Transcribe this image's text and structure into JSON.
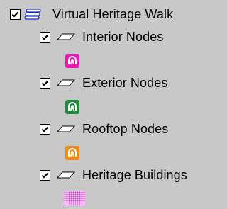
{
  "root": {
    "label": "Virtual Heritage Walk",
    "checked": true,
    "icon": "stacked-layers-icon"
  },
  "layers": [
    {
      "label": "Interior Nodes",
      "checked": true,
      "icon": "polygon-layer-icon",
      "symbol": "marker-icon",
      "symbol_color": "#e81ab4"
    },
    {
      "label": "Exterior Nodes",
      "checked": true,
      "icon": "polygon-layer-icon",
      "symbol": "marker-icon",
      "symbol_color": "#1e8a3a"
    },
    {
      "label": "Rooftop Nodes",
      "checked": true,
      "icon": "polygon-layer-icon",
      "symbol": "marker-icon",
      "symbol_color": "#f08a12"
    },
    {
      "label": "Heritage Buildings",
      "checked": true,
      "icon": "polygon-layer-icon",
      "symbol": "dotted-fill-swatch",
      "symbol_color": "#d23cd2"
    }
  ]
}
